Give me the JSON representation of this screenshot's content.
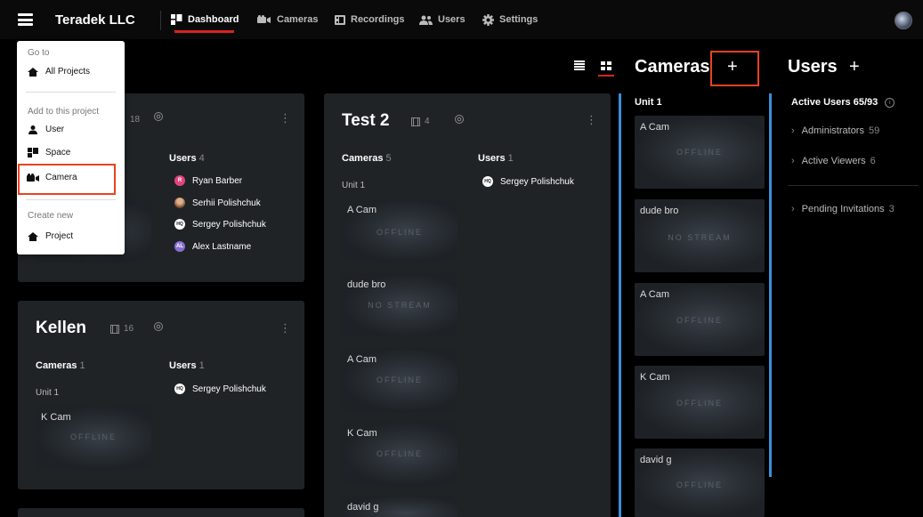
{
  "app": {
    "company": "Teradek LLC",
    "nav": [
      {
        "label": "Dashboard",
        "active": true,
        "icon": "dashboard-icon"
      },
      {
        "label": "Cameras",
        "active": false,
        "icon": "camera-icon"
      },
      {
        "label": "Recordings",
        "active": false,
        "icon": "recordings-icon"
      },
      {
        "label": "Users",
        "active": false,
        "icon": "users-icon"
      },
      {
        "label": "Settings",
        "active": false,
        "icon": "gear-icon"
      }
    ]
  },
  "menu": {
    "goto_header": "Go to",
    "all_projects": "All Projects",
    "add_header": "Add to this project",
    "user": "User",
    "space": "Space",
    "camera": "Camera",
    "create_header": "Create new",
    "project": "Project"
  },
  "project1": {
    "meta_count": "18",
    "users_label": "Users",
    "users_count": "4",
    "users": [
      {
        "initials": "R",
        "name": "Ryan Barber",
        "color": "#e0457b"
      },
      {
        "initials": "",
        "name": "Serhii Polishchuk",
        "color": "#8a5a3a"
      },
      {
        "initials": "HQ",
        "name": "Sergey Polishchuk",
        "color": "#ffffff"
      },
      {
        "initials": "AL",
        "name": "Alex Lastname",
        "color": "#8a6fd1"
      }
    ]
  },
  "test2": {
    "title": "Test 2",
    "meta_count": "4",
    "cameras_label": "Cameras",
    "cameras_count": "5",
    "users_label": "Users",
    "users_count": "1",
    "unit": "Unit 1",
    "user": "Sergey Polishchuk",
    "cams": [
      {
        "name": "A Cam",
        "status": "OFFLINE"
      },
      {
        "name": "dude bro",
        "status": "NO STREAM"
      },
      {
        "name": "A Cam",
        "status": "OFFLINE"
      },
      {
        "name": "K Cam",
        "status": "OFFLINE"
      },
      {
        "name": "david g",
        "status": ""
      }
    ]
  },
  "kellen": {
    "title": "Kellen",
    "meta_count": "16",
    "cameras_label": "Cameras",
    "cameras_count": "1",
    "users_label": "Users",
    "users_count": "1",
    "unit": "Unit 1",
    "user": "Sergey Polishchuk",
    "cam": {
      "name": "K Cam",
      "status": "OFFLINE"
    }
  },
  "cameras_col": {
    "title": "Cameras",
    "plus": "+",
    "unit": "Unit 1",
    "cams": [
      {
        "name": "A Cam",
        "status": "OFFLINE"
      },
      {
        "name": "dude bro",
        "status": "NO STREAM"
      },
      {
        "name": "A Cam",
        "status": "OFFLINE"
      },
      {
        "name": "K Cam",
        "status": "OFFLINE"
      },
      {
        "name": "david g",
        "status": "OFFLINE"
      }
    ]
  },
  "users_col": {
    "title": "Users",
    "plus": "+",
    "active_users": "Active Users 65/93",
    "administrators": "Administrators",
    "administrators_count": "59",
    "active_viewers": "Active Viewers",
    "active_viewers_count": "6",
    "pending": "Pending Invitations",
    "pending_count": "3"
  },
  "colors": {
    "accent_red": "#d9231f",
    "highlight_orange": "#e8431f",
    "scroll_blue": "#3b8fd8",
    "card_bg": "#202326"
  }
}
